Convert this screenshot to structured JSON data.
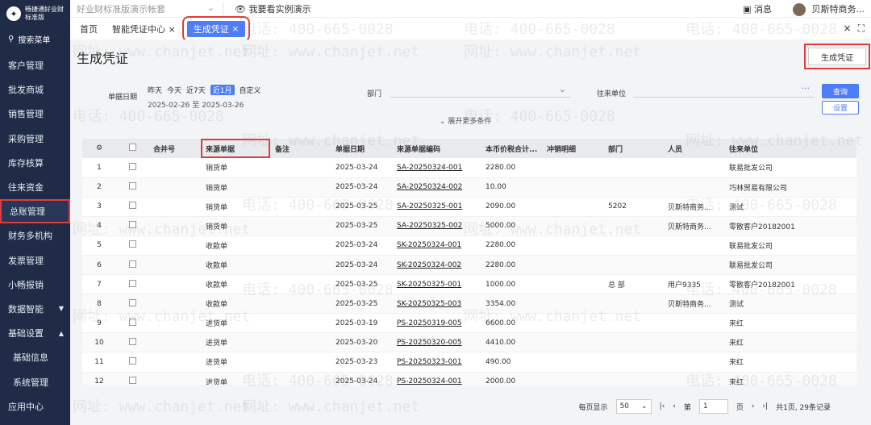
{
  "sidebar": {
    "logo_name": "畅捷通好业财",
    "logo_edition": "标准版",
    "search_label": "搜索菜单",
    "items": [
      {
        "label": "客户管理"
      },
      {
        "label": "批发商城"
      },
      {
        "label": "销售管理"
      },
      {
        "label": "采购管理"
      },
      {
        "label": "库存核算"
      },
      {
        "label": "往来资金"
      },
      {
        "label": "总账管理"
      },
      {
        "label": "财务多机构"
      },
      {
        "label": "发票管理"
      },
      {
        "label": "小畅报销"
      },
      {
        "label": "数据智能"
      },
      {
        "label": "基础设置"
      },
      {
        "label": "基础信息"
      },
      {
        "label": "系统管理"
      },
      {
        "label": "应用中心"
      }
    ]
  },
  "topbar": {
    "account": "好业财标准版演示帐套",
    "demo_link": "我要看实例演示",
    "messages": "消息",
    "user": "贝斯特商务..."
  },
  "tabs": {
    "home": "首页",
    "voucher_center": "智能凭证中心",
    "current": "生成凭证"
  },
  "page": {
    "title": "生成凭证",
    "generate_button": "生成凭证"
  },
  "filter": {
    "date_label": "单据日期",
    "quick": [
      "昨天",
      "今天",
      "近7天",
      "近1月",
      "自定义"
    ],
    "quick_selected": "近1月",
    "range_start": "2025-02-26",
    "range_sep": "至",
    "range_end": "2025-03-26",
    "dept_label": "部门",
    "partner_label": "往来单位",
    "query_button": "查询",
    "settings_button": "设置",
    "more": "展开更多条件"
  },
  "table": {
    "columns": [
      "合并号",
      "来源单据",
      "备注",
      "单据日期",
      "来源单据编码",
      "本币价税合计...",
      "冲销明细",
      "部门",
      "人员",
      "往来单位"
    ],
    "rows": [
      {
        "n": "1",
        "src": "销货单",
        "date": "2025-03-24",
        "code": "SA-20250324-001",
        "amt": "2280.00",
        "dept": "",
        "person": "",
        "partner": "联易批发公司"
      },
      {
        "n": "2",
        "src": "销货单",
        "date": "2025-03-24",
        "code": "SA-20250324-002",
        "amt": "10.00",
        "dept": "",
        "person": "",
        "partner": "巧林贸易有限公司"
      },
      {
        "n": "3",
        "src": "销货单",
        "date": "2025-03-25",
        "code": "SA-20250325-001",
        "amt": "2090.00",
        "dept": "5202",
        "person": "贝斯特商务...",
        "partner": "测试"
      },
      {
        "n": "4",
        "src": "销货单",
        "date": "2025-03-25",
        "code": "SA-20250325-002",
        "amt": "5000.00",
        "dept": "",
        "person": "贝斯特商务...",
        "partner": "零散客户20182001"
      },
      {
        "n": "5",
        "src": "收款单",
        "date": "2025-03-24",
        "code": "SK-20250324-001",
        "amt": "2280.00",
        "dept": "",
        "person": "",
        "partner": "联易批发公司"
      },
      {
        "n": "6",
        "src": "收款单",
        "date": "2025-03-24",
        "code": "SK-20250324-002",
        "amt": "2280.00",
        "dept": "",
        "person": "",
        "partner": "联易批发公司"
      },
      {
        "n": "7",
        "src": "收款单",
        "date": "2025-03-25",
        "code": "SK-20250325-001",
        "amt": "1000.00",
        "dept": "总 部",
        "person": "用户9335",
        "partner": "零散客户20182001"
      },
      {
        "n": "8",
        "src": "收款单",
        "date": "2025-03-25",
        "code": "SK-20250325-003",
        "amt": "3354.00",
        "dept": "",
        "person": "贝斯特商务...",
        "partner": "测试"
      },
      {
        "n": "9",
        "src": "进货单",
        "date": "2025-03-19",
        "code": "PS-20250319-005",
        "amt": "6600.00",
        "dept": "",
        "person": "",
        "partner": "来红"
      },
      {
        "n": "10",
        "src": "进货单",
        "date": "2025-03-20",
        "code": "PS-20250320-005",
        "amt": "4410.00",
        "dept": "",
        "person": "",
        "partner": "来红"
      },
      {
        "n": "11",
        "src": "进货单",
        "date": "2025-03-23",
        "code": "PS-20250323-001",
        "amt": "490.00",
        "dept": "",
        "person": "",
        "partner": "来红"
      },
      {
        "n": "12",
        "src": "进货单",
        "date": "2025-03-24",
        "code": "PS-20250324-001",
        "amt": "2000.00",
        "dept": "",
        "person": "",
        "partner": "来红"
      }
    ]
  },
  "pager": {
    "per_page_label": "每页显示",
    "per_page": "50",
    "page_prefix": "第",
    "page": "1",
    "page_suffix": "页",
    "summary": "共1页, 29条记录"
  },
  "watermark": {
    "phone": "电话: 400-665-0028",
    "site": "网址: www.chanjet.net"
  },
  "colors": {
    "accent": "#4f7cf7",
    "sidebar": "#1f2b47",
    "highlight": "#e23b3b"
  }
}
